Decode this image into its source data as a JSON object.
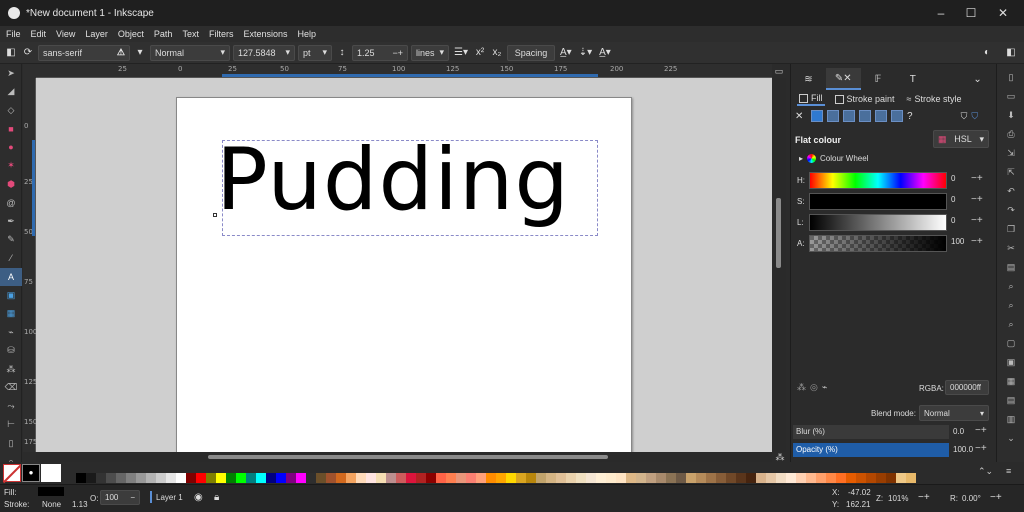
{
  "window": {
    "title": "*New document 1 - Inkscape",
    "minimize": "–",
    "maximize": "☐",
    "close": "✕"
  },
  "menu": [
    "File",
    "Edit",
    "View",
    "Layer",
    "Object",
    "Path",
    "Text",
    "Filters",
    "Extensions",
    "Help"
  ],
  "text_toolbar": {
    "font_family": "sans-serif",
    "font_style": "Normal",
    "font_size": "127.5848",
    "unit": "pt",
    "line_spacing": "1.25",
    "line_spacing_unit": "lines",
    "spacing_label": "Spacing"
  },
  "canvas": {
    "text": "Pudding",
    "ruler_top_labels": [
      "25",
      "0",
      "25",
      "50",
      "75",
      "100",
      "125",
      "150",
      "175",
      "200",
      "225"
    ],
    "ruler_left_labels": [
      "0",
      "25",
      "50",
      "75",
      "100",
      "125",
      "150",
      "175"
    ]
  },
  "panel": {
    "subtabs": [
      "Fill",
      "Stroke paint",
      "Stroke style"
    ],
    "flat_colour_label": "Flat colour",
    "colour_model": "HSL",
    "colour_wheel_label": "Colour Wheel",
    "unknown_marker": "?",
    "sliders": [
      {
        "label": "H:",
        "value": "0"
      },
      {
        "label": "S:",
        "value": "0"
      },
      {
        "label": "L:",
        "value": "0"
      },
      {
        "label": "A:",
        "value": "100"
      }
    ],
    "rgba_label": "RGBA:",
    "rgba_value": "000000ff",
    "blend_label": "Blend mode:",
    "blend_value": "Normal",
    "blur_label": "Blur (%)",
    "blur_value": "0.0",
    "opacity_label": "Opacity (%)",
    "opacity_value": "100.0"
  },
  "palette_colors": [
    "#000000",
    "#1a1a1a",
    "#333333",
    "#4d4d4d",
    "#666666",
    "#808080",
    "#999999",
    "#b3b3b3",
    "#cccccc",
    "#e6e6e6",
    "#ffffff",
    "#800000",
    "#ff0000",
    "#808000",
    "#ffff00",
    "#008000",
    "#00ff00",
    "#008080",
    "#00ffff",
    "#000080",
    "#0000ff",
    "#800080",
    "#ff00ff",
    "#2e2e2e",
    "#6b4f2a",
    "#a0522d",
    "#d2691e",
    "#f4a460",
    "#ffdab9",
    "#ffe4e1",
    "#f5deb3",
    "#bc8f8f",
    "#cd5c5c",
    "#dc143c",
    "#b22222",
    "#8b0000",
    "#ff6347",
    "#ff7f50",
    "#e9967a",
    "#fa8072",
    "#ffa07a",
    "#ff8c00",
    "#ffa500",
    "#ffd700",
    "#daa520",
    "#b8860b",
    "#c1a36b",
    "#d4b483",
    "#e0c097",
    "#ead2ac",
    "#f0e0c0",
    "#f5e6d3",
    "#ffefd5",
    "#ffebcd",
    "#ffe4c4",
    "#deb887",
    "#d2b48c",
    "#c0a080",
    "#a88a6c",
    "#8b7355",
    "#6e5a46",
    "#c9a26b",
    "#b58b5a",
    "#9e7348",
    "#875d38",
    "#704828",
    "#5a351b",
    "#46240f",
    "#d9b38c",
    "#e6c7a6",
    "#f2dcc3",
    "#ffe9d6",
    "#ffd1b3",
    "#ffb98f",
    "#ffa06b",
    "#ff8847",
    "#ff6f23",
    "#e65c00",
    "#cc5200",
    "#b34700",
    "#993d00",
    "#803300",
    "#f0c987",
    "#e8b96a"
  ],
  "status": {
    "fill_label": "Fill:",
    "stroke_label": "Stroke:",
    "stroke_value": "None",
    "stroke_width": "1.13",
    "opacity_prefix": "O:",
    "opacity_value": "100",
    "layer": "Layer 1",
    "x_label": "X:",
    "x_value": "-47.02",
    "y_label": "Y:",
    "y_value": "162.21",
    "zoom_label": "Z:",
    "zoom_value": "101%",
    "rotate_label": "R:",
    "rotate_value": "0.00°"
  },
  "accent_color": "#5a8fd6"
}
